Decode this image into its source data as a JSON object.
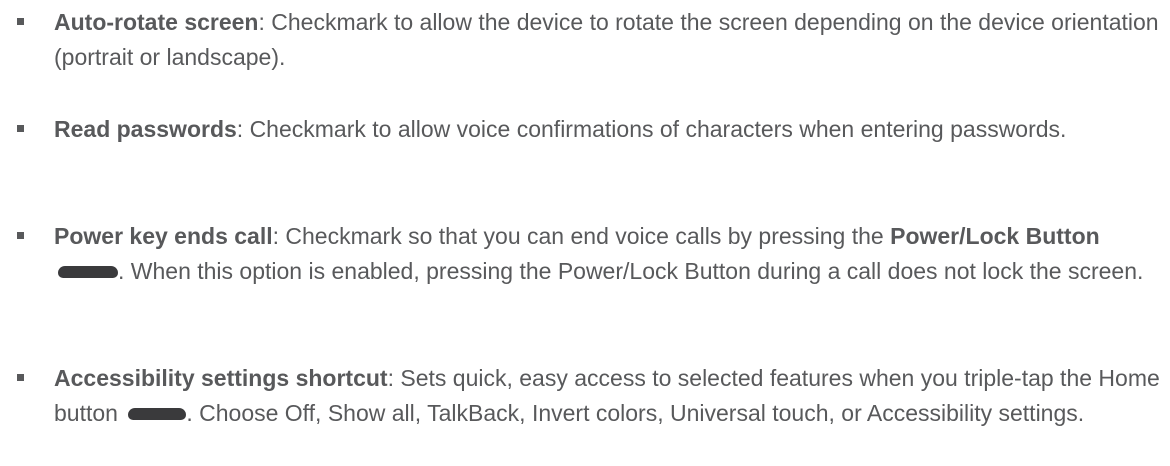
{
  "items": [
    {
      "term": "Auto-rotate screen",
      "desc": ": Checkmark to allow the device to rotate the screen depending on the device orientation (portrait or landscape)."
    },
    {
      "term": "Read passwords",
      "desc": ": Checkmark to allow voice confirmations of characters when entering passwords."
    },
    {
      "term": "Power key ends call",
      "desc_before": ": Checkmark so that you can end voice calls by pressing the ",
      "button_name": "Power/Lock Button",
      "desc_after": ". When this option is enabled, pressing the Power/Lock Button during a call does not lock the screen.",
      "icon": "power-lock-button-icon"
    },
    {
      "term": "Accessibility settings shortcut",
      "desc_before": ": Sets quick, easy access to selected features when you triple-tap the Home button ",
      "desc_after": ". Choose Off, Show all, TalkBack, Invert colors, Universal touch, or Accessibility settings.",
      "icon": "home-button-icon"
    }
  ]
}
